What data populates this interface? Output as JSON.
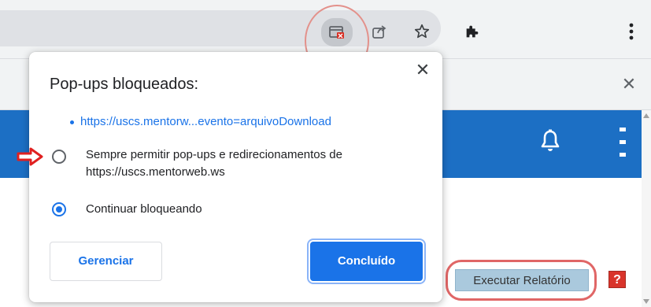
{
  "colors": {
    "accent": "#1a73e8",
    "page_header": "#1c6fc4",
    "annotation_red": "#e02020",
    "run_report_bg": "#aac9dd"
  },
  "toolbar": {
    "icons": [
      "popup-blocked-icon",
      "share-icon",
      "star-icon",
      "puzzle-icon",
      "menu-icon"
    ]
  },
  "page": {
    "run_report_label": "Executar Relatório",
    "help_label": "?"
  },
  "popup": {
    "title": "Pop-ups bloqueados:",
    "blocked_link": "https://uscs.mentorw...evento=arquivoDownload",
    "options": [
      {
        "label": "Sempre permitir pop-ups e redirecionamentos de https://uscs.mentorweb.ws",
        "selected": false
      },
      {
        "label": "Continuar bloqueando",
        "selected": true
      }
    ],
    "manage_label": "Gerenciar",
    "done_label": "Concluído"
  }
}
